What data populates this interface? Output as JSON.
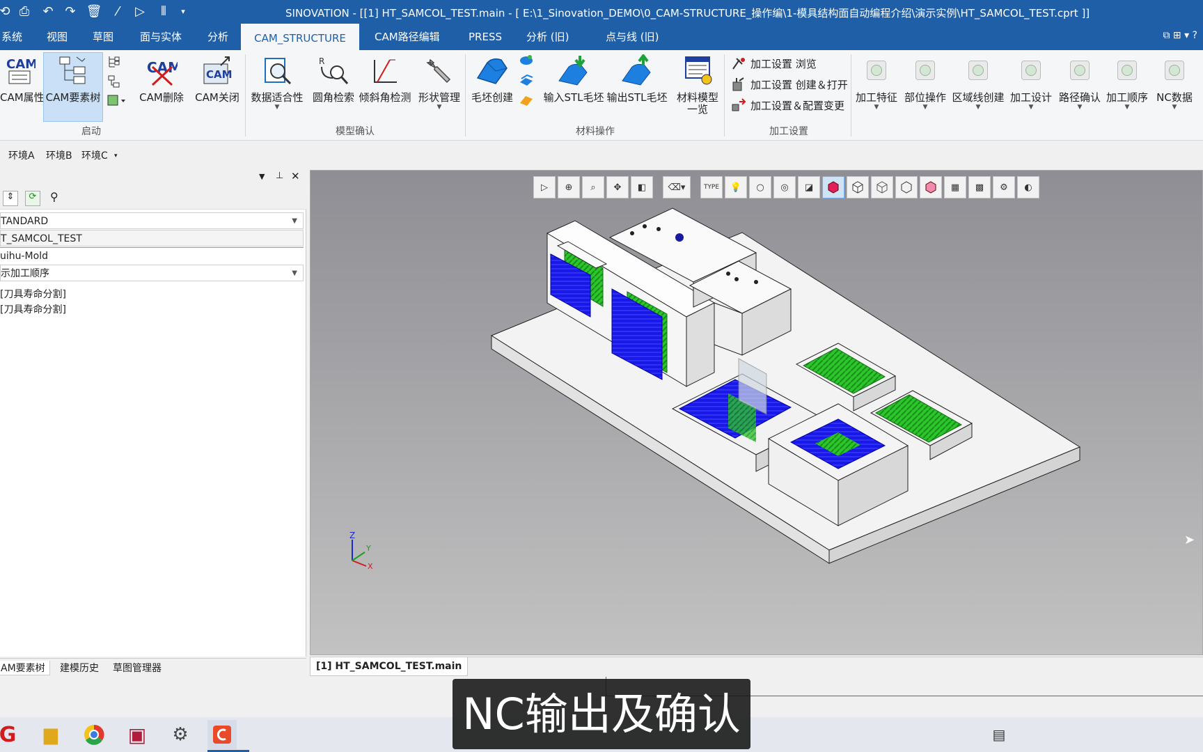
{
  "titlebar": {
    "title": "SINOVATION - [[1] HT_SAMCOL_TEST.main - [ E:\\1_Sinovation_DEMO\\0_CAM-STRUCTURE_操作编\\1-模具结构面自动编程介绍\\演示实例\\HT_SAMCOL_TEST.cprt ]]"
  },
  "menu": {
    "tabs": [
      "系统",
      "视图",
      "草图",
      "面与实体",
      "分析",
      "CAM_STRUCTURE",
      "CAM路径编辑",
      "PRESS",
      "分析 (旧)",
      "点与线 (旧)"
    ],
    "active": "CAM_STRUCTURE"
  },
  "ribbon": {
    "buttons": {
      "cam_props": "CAM属性",
      "cam_tree": "CAM要素树",
      "cam_delete": "CAM删除",
      "cam_close": "CAM关闭",
      "data_fit": "数据适合性",
      "fillet_search": "圆角检索",
      "draft_check": "倾斜角检测",
      "shape_mgmt": "形状管理",
      "blank_create": "毛坯创建",
      "import_stl": "输入STL毛坯",
      "export_stl": "输出STL毛坯",
      "material_list_1": "材料模型",
      "material_list_2": "一览",
      "setup_browse": "加工设置 浏览",
      "setup_create": "加工设置 创建＆打开",
      "setup_config": "加工设置＆配置变更",
      "mach_feature": "加工特征",
      "part_op": "部位操作",
      "region_line": "区域线创建",
      "mach_design": "加工设计",
      "path_confirm": "路径确认",
      "mach_order": "加工顺序",
      "nc_data": "NC数据"
    },
    "cam_logo": "CAM",
    "groups": {
      "start": "启动",
      "model_confirm": "模型确认",
      "material_op": "材料操作",
      "mach_setup": "加工设置"
    }
  },
  "env": {
    "tabs": [
      "环境A",
      "环境B",
      "环境C"
    ]
  },
  "leftpanel": {
    "dropdown1": "TANDARD",
    "field1": "T_SAMCOL_TEST",
    "field2": "uihu-Mold",
    "dropdown2": "示加工顺序",
    "tree_items": [
      "[刀具寿命分割]",
      "[刀具寿命分割]"
    ],
    "bottom_tabs": [
      "AM要素树",
      "建模历史",
      "草图管理器"
    ]
  },
  "viewport": {
    "toolbar_type": "TYPE",
    "axes": {
      "z": "Z",
      "y": "Y",
      "x": "X"
    }
  },
  "doctab": {
    "label": "[1] HT_SAMCOL_TEST.main"
  },
  "caption": {
    "text": "NC输出及确认"
  },
  "colors": {
    "titlebar": "#1f5fa8",
    "selected": "#c9e0f7",
    "toolpath_blue": "#1010e0",
    "face_green": "#22c020"
  }
}
